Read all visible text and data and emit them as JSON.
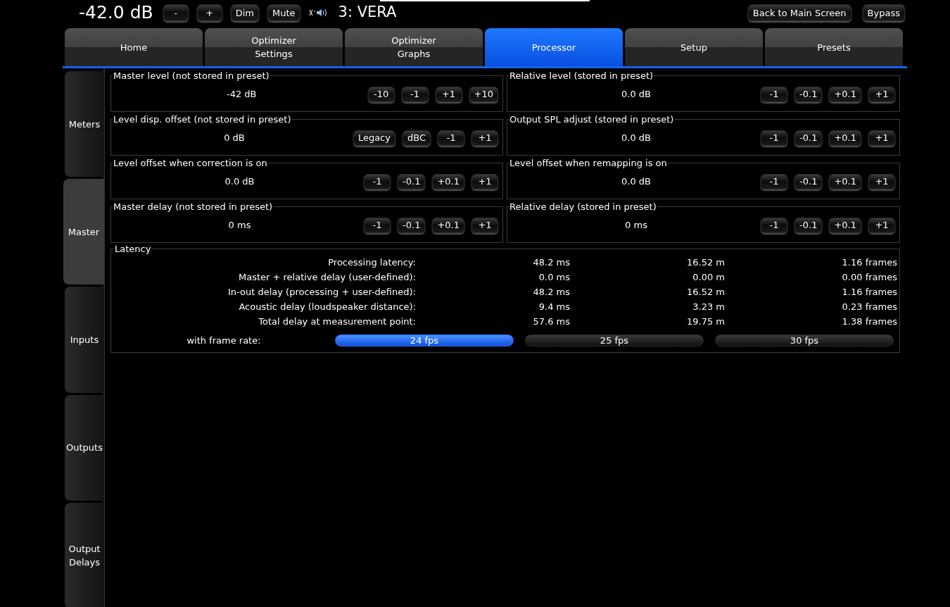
{
  "header": {
    "level": "-42.0 dB",
    "buttons": [
      "-",
      "+",
      "Dim",
      "Mute"
    ],
    "preset": "3: VERA",
    "right_buttons": [
      "Back to Main Screen",
      "Bypass"
    ]
  },
  "tabs": [
    {
      "label": "Home",
      "selected": false
    },
    {
      "label": "Optimizer\nSettings",
      "selected": false
    },
    {
      "label": "Optimizer\nGraphs",
      "selected": false
    },
    {
      "label": "Processor",
      "selected": true
    },
    {
      "label": "Setup",
      "selected": false
    },
    {
      "label": "Presets",
      "selected": false
    }
  ],
  "side_tabs": [
    {
      "label": "Meters",
      "selected": false
    },
    {
      "label": "Master",
      "selected": true
    },
    {
      "label": "Inputs",
      "selected": false
    },
    {
      "label": "Outputs",
      "selected": false
    },
    {
      "label": "Output\nDelays",
      "selected": false
    }
  ],
  "groups": [
    {
      "title": "Master level (not stored in preset)",
      "value": "-42 dB",
      "buttons": [
        "-10",
        "-1",
        "+1",
        "+10"
      ]
    },
    {
      "title": "Relative level (stored in preset)",
      "value": "0.0 dB",
      "buttons": [
        "-1",
        "-0.1",
        "+0.1",
        "+1"
      ]
    },
    {
      "title": "Level disp. offset (not stored in preset)",
      "value": "0 dB",
      "buttons": [
        "Legacy",
        "dBC",
        "-1",
        "+1"
      ]
    },
    {
      "title": "Output SPL adjust (stored in preset)",
      "value": "0.0 dB",
      "buttons": [
        "-1",
        "-0.1",
        "+0.1",
        "+1"
      ]
    },
    {
      "title": "Level offset when correction is on",
      "value": "0.0 dB",
      "buttons": [
        "-1",
        "-0.1",
        "+0.1",
        "+1"
      ]
    },
    {
      "title": "Level offset when remapping is on",
      "value": "0.0 dB",
      "buttons": [
        "-1",
        "-0.1",
        "+0.1",
        "+1"
      ]
    },
    {
      "title": "Master delay (not stored in preset)",
      "value": "0 ms",
      "buttons": [
        "-1",
        "-0.1",
        "+0.1",
        "+1"
      ]
    },
    {
      "title": "Relative delay (stored in preset)",
      "value": "0 ms",
      "buttons": [
        "-1",
        "-0.1",
        "+0.1",
        "+1"
      ]
    }
  ],
  "latency": {
    "title": "Latency",
    "rows": [
      [
        "Processing latency:",
        "48.2 ms",
        "16.52 m",
        "1.16 frames"
      ],
      [
        "Master + relative delay (user-defined):",
        "0.0 ms",
        "0.00 m",
        "0.00 frames"
      ],
      [
        "In-out delay (processing + user-defined):",
        "48.2 ms",
        "16.52 m",
        "1.16 frames"
      ],
      [
        "Acoustic delay (loudspeaker distance):",
        "9.4 ms",
        "3.23 m",
        "0.23 frames"
      ],
      [
        "Total delay at measurement point:",
        "57.6 ms",
        "19.75 m",
        "1.38 frames"
      ]
    ],
    "frame_rate_label": "with frame rate:",
    "frame_rates": [
      {
        "label": "24 fps",
        "selected": true
      },
      {
        "label": "25 fps",
        "selected": false
      },
      {
        "label": "30 fps",
        "selected": false
      }
    ]
  }
}
